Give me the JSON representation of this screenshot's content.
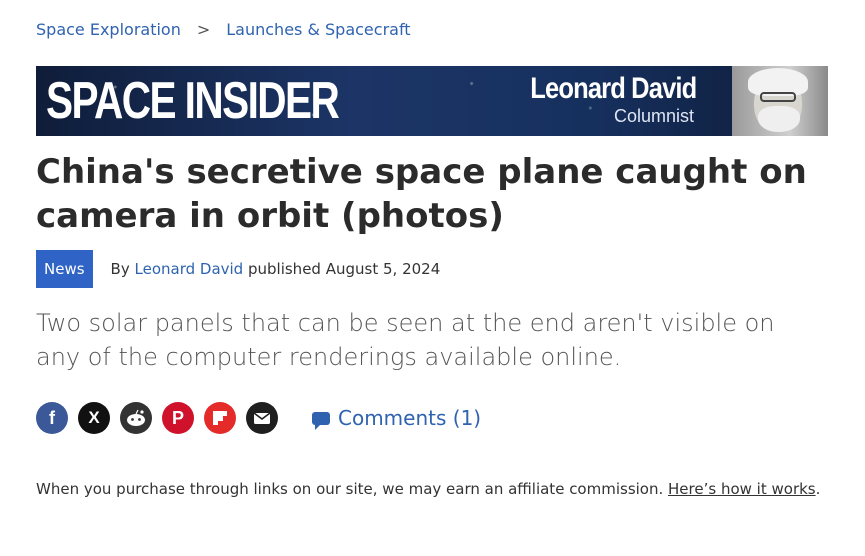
{
  "breadcrumb": {
    "items": [
      "Space Exploration",
      "Launches & Spacecraft"
    ],
    "separator": ">"
  },
  "banner": {
    "title": "SPACE INSIDER",
    "name": "Leonard David",
    "role": "Columnist"
  },
  "article": {
    "headline": "China's secretive space plane caught on camera in orbit (photos)",
    "badge": "News",
    "by": "By",
    "author": "Leonard David",
    "published_prefix": "published",
    "date": "August 5, 2024",
    "subtitle": "Two solar panels that can be seen at the end aren't visible on any of the computer renderings available online."
  },
  "share": {
    "icons": [
      "facebook-icon",
      "x-icon",
      "reddit-icon",
      "pinterest-icon",
      "flipboard-icon",
      "email-icon"
    ],
    "glyphs": {
      "facebook": "f",
      "x": "X",
      "reddit": "●",
      "pinterest": "P",
      "flipboard": "F",
      "email": "✉"
    },
    "comments_label": "Comments (1)"
  },
  "affiliate": {
    "text": "When you purchase through links on our site, we may earn an affiliate commission. ",
    "link": "Here’s how it works",
    "end": "."
  },
  "colors": {
    "link": "#2f63b0",
    "badge": "#2f63c5",
    "facebook": "#3b5998",
    "pinterest": "#d0112b",
    "flipboard": "#e42b2a"
  }
}
